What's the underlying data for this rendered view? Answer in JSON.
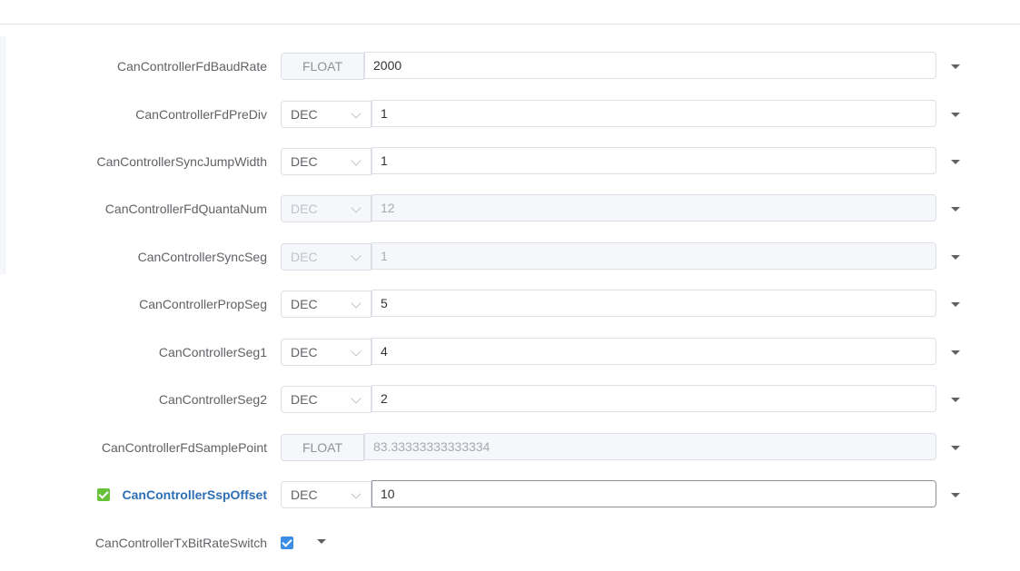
{
  "rows": [
    {
      "label": "CanControllerFdBaudRate",
      "format": "FLOAT",
      "value": "2000"
    },
    {
      "label": "CanControllerFdPreDiv",
      "format": "DEC",
      "value": "1"
    },
    {
      "label": "CanControllerSyncJumpWidth",
      "format": "DEC",
      "value": "1"
    },
    {
      "label": "CanControllerFdQuantaNum",
      "format": "DEC",
      "value": "12"
    },
    {
      "label": "CanControllerSyncSeg",
      "format": "DEC",
      "value": "1"
    },
    {
      "label": "CanControllerPropSeg",
      "format": "DEC",
      "value": "5"
    },
    {
      "label": "CanControllerSeg1",
      "format": "DEC",
      "value": "4"
    },
    {
      "label": "CanControllerSeg2",
      "format": "DEC",
      "value": "2"
    },
    {
      "label": "CanControllerFdSamplePoint",
      "format": "FLOAT",
      "value": "83.33333333333334"
    },
    {
      "label": "CanControllerSspOffset",
      "format": "DEC",
      "value": "10"
    },
    {
      "label": "CanControllerTxBitRateSwitch"
    }
  ],
  "icons": {
    "expand": "caret-down-icon",
    "select": "chevron-down-icon",
    "enabled": "checkbox-checked-icon"
  },
  "colors": {
    "active_label": "#2e6eb5",
    "enabled_check": "#67c23a",
    "toggle_check": "#3a8ee6"
  }
}
